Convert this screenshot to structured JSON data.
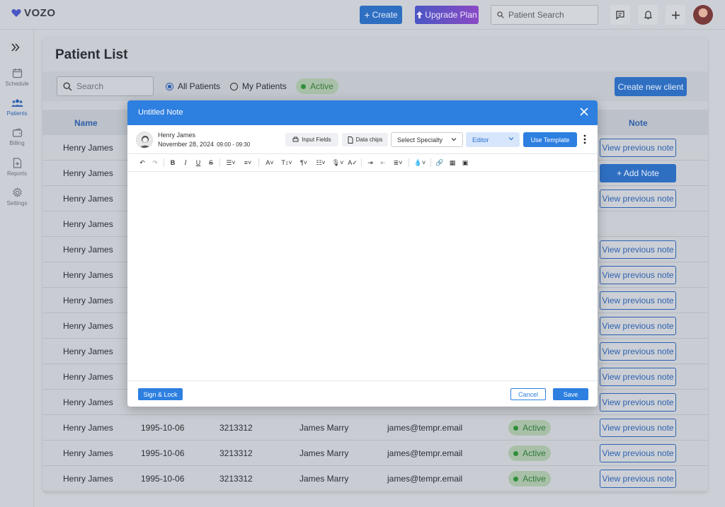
{
  "app": {
    "logo_text": "VOZO"
  },
  "topbar": {
    "create_label": "Create",
    "upgrade_label": "Upgrade Plan",
    "search_placeholder": "Patient Search"
  },
  "sidebar": {
    "items": [
      {
        "label": "Schedule",
        "icon": "calendar-icon"
      },
      {
        "label": "Patients",
        "icon": "patients-icon"
      },
      {
        "label": "Billing",
        "icon": "wallet-icon"
      },
      {
        "label": "Reports",
        "icon": "report-icon"
      },
      {
        "label": "Settings",
        "icon": "gear-icon"
      }
    ]
  },
  "page": {
    "title": "Patient List",
    "search_placeholder": "Search",
    "filters": {
      "all": "All Patients",
      "mine": "My Patients",
      "active": "Active"
    },
    "create_client_label": "Create new client"
  },
  "table": {
    "headers": {
      "name": "Name",
      "note": "Note"
    },
    "rows": [
      {
        "name": "Henry James",
        "dob": "",
        "phone": "",
        "contact": "",
        "email": "",
        "status": "",
        "note": "View previous note"
      },
      {
        "name": "Henry James",
        "dob": "",
        "phone": "",
        "contact": "",
        "email": "",
        "status": "",
        "note": "+ Add Note"
      },
      {
        "name": "Henry James",
        "dob": "",
        "phone": "",
        "contact": "",
        "email": "",
        "status": "",
        "note": "View previous note"
      },
      {
        "name": "Henry James",
        "dob": "",
        "phone": "",
        "contact": "",
        "email": "",
        "status": "",
        "note": ""
      },
      {
        "name": "Henry James",
        "dob": "",
        "phone": "",
        "contact": "",
        "email": "",
        "status": "",
        "note": "View previous note"
      },
      {
        "name": "Henry James",
        "dob": "",
        "phone": "",
        "contact": "",
        "email": "",
        "status": "",
        "note": "View previous note"
      },
      {
        "name": "Henry James",
        "dob": "",
        "phone": "",
        "contact": "",
        "email": "",
        "status": "",
        "note": "View previous note"
      },
      {
        "name": "Henry James",
        "dob": "",
        "phone": "",
        "contact": "",
        "email": "",
        "status": "",
        "note": "View previous note"
      },
      {
        "name": "Henry James",
        "dob": "",
        "phone": "",
        "contact": "",
        "email": "",
        "status": "",
        "note": "View previous note"
      },
      {
        "name": "Henry James",
        "dob": "",
        "phone": "",
        "contact": "",
        "email": "",
        "status": "",
        "note": "View previous note"
      },
      {
        "name": "Henry James",
        "dob": "",
        "phone": "",
        "contact": "",
        "email": "",
        "status": "",
        "note": "View previous note"
      },
      {
        "name": "Henry James",
        "dob": "1995-10-06",
        "phone": "3213312",
        "contact": "James Marry",
        "email": "james@tempr.email",
        "status": "Active",
        "note": "View previous note"
      },
      {
        "name": "Henry James",
        "dob": "1995-10-06",
        "phone": "3213312",
        "contact": "James Marry",
        "email": "james@tempr.email",
        "status": "Active",
        "note": "View previous note"
      },
      {
        "name": "Henry James",
        "dob": "1995-10-06",
        "phone": "3213312",
        "contact": "James Marry",
        "email": "james@tempr.email",
        "status": "Active",
        "note": "View previous note"
      }
    ]
  },
  "modal": {
    "title": "Untitled Note",
    "patient_name": "Henry James",
    "date": "November 28, 2024",
    "time": "09:00 - 09:30",
    "input_fields_label": "Input Fields",
    "data_chips_label": "Data chips",
    "specialty_placeholder": "Select Specialty",
    "editor_label": "Editor",
    "use_template_label": "Use Template",
    "sign_lock_label": "Sign & Lock",
    "cancel_label": "Cancel",
    "save_label": "Save"
  },
  "colors": {
    "primary": "#2d7fe0",
    "active_green": "#2f8f3a",
    "upgrade_start": "#4a56c4",
    "upgrade_end": "#8a4ac4"
  }
}
